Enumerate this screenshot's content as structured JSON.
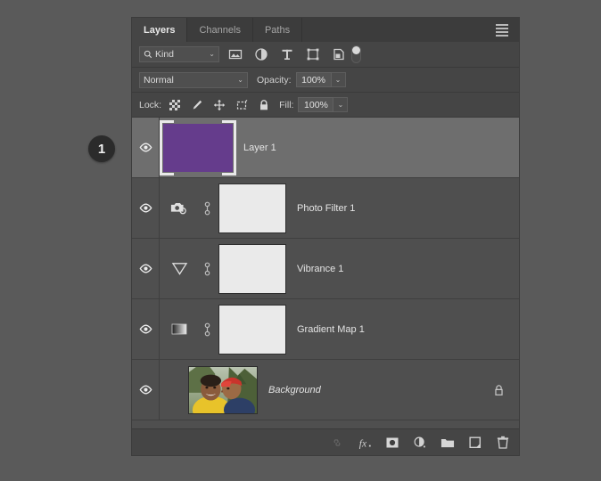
{
  "annotation": {
    "badge_number": "1"
  },
  "panel": {
    "tabs": [
      {
        "label": "Layers",
        "active": true
      },
      {
        "label": "Channels",
        "active": false
      },
      {
        "label": "Paths",
        "active": false
      }
    ],
    "menu_icon": "hamburger-menu-icon"
  },
  "filter_row": {
    "kind_label": "Kind",
    "search_icon": "search-icon",
    "dropdown_chevron": "⌄",
    "icons": [
      {
        "name": "filter-pixel-layers-icon"
      },
      {
        "name": "filter-adjustment-layers-icon"
      },
      {
        "name": "filter-type-layers-icon"
      },
      {
        "name": "filter-shape-layers-icon"
      },
      {
        "name": "filter-smart-object-layers-icon"
      }
    ],
    "toggle_name": "filter-enable-toggle"
  },
  "blend_row": {
    "blend_mode": "Normal",
    "opacity_label": "Opacity:",
    "opacity_value": "100%",
    "chevron": "⌄"
  },
  "lock_row": {
    "lock_label": "Lock:",
    "lock_icons": [
      {
        "name": "lock-transparent-pixels-icon"
      },
      {
        "name": "lock-image-pixels-icon"
      },
      {
        "name": "lock-position-icon"
      },
      {
        "name": "lock-artboard-nesting-icon"
      },
      {
        "name": "lock-all-icon"
      }
    ],
    "fill_label": "Fill:",
    "fill_value": "100%",
    "chevron": "⌄"
  },
  "layers": [
    {
      "name": "Layer 1",
      "selected": true,
      "italic": false,
      "thumb_type": "color",
      "thumb_color": "#653c8c",
      "has_adjustment_icon": false,
      "has_link": false,
      "has_mask": false,
      "locked": false,
      "visible": true
    },
    {
      "name": "Photo Filter 1",
      "selected": false,
      "italic": false,
      "thumb_type": "mask",
      "thumb_color": "#eaeaea",
      "has_adjustment_icon": true,
      "adjustment_icon": "photo-filter-icon",
      "has_link": true,
      "has_mask": true,
      "locked": false,
      "visible": true
    },
    {
      "name": "Vibrance 1",
      "selected": false,
      "italic": false,
      "thumb_type": "mask",
      "thumb_color": "#eaeaea",
      "has_adjustment_icon": true,
      "adjustment_icon": "vibrance-icon",
      "has_link": true,
      "has_mask": true,
      "locked": false,
      "visible": true
    },
    {
      "name": "Gradient Map 1",
      "selected": false,
      "italic": false,
      "thumb_type": "mask",
      "thumb_color": "#eaeaea",
      "has_adjustment_icon": true,
      "adjustment_icon": "gradient-map-icon",
      "has_link": true,
      "has_mask": true,
      "locked": false,
      "visible": true
    },
    {
      "name": "Background",
      "selected": false,
      "italic": true,
      "thumb_type": "photo",
      "thumb_color": "#7f8d5e",
      "has_adjustment_icon": false,
      "has_link": false,
      "has_mask": false,
      "locked": true,
      "visible": true
    }
  ],
  "footer": {
    "buttons": [
      {
        "name": "link-layers-button",
        "enabled": false
      },
      {
        "name": "layer-style-fx-button",
        "enabled": true
      },
      {
        "name": "add-layer-mask-button",
        "enabled": true
      },
      {
        "name": "new-adjustment-layer-button",
        "enabled": true
      },
      {
        "name": "new-group-button",
        "enabled": true
      },
      {
        "name": "new-layer-button",
        "enabled": true
      },
      {
        "name": "delete-layer-button",
        "enabled": true
      }
    ]
  },
  "colors": {
    "page_background": "#5a5a5a",
    "panel_background": "#454545",
    "row_background": "#4f4f4f",
    "row_selected": "#6e6e6e",
    "tabbar_background": "#3c3c3c",
    "text": "#e4e4e4",
    "layer1_purple": "#653c8c"
  }
}
